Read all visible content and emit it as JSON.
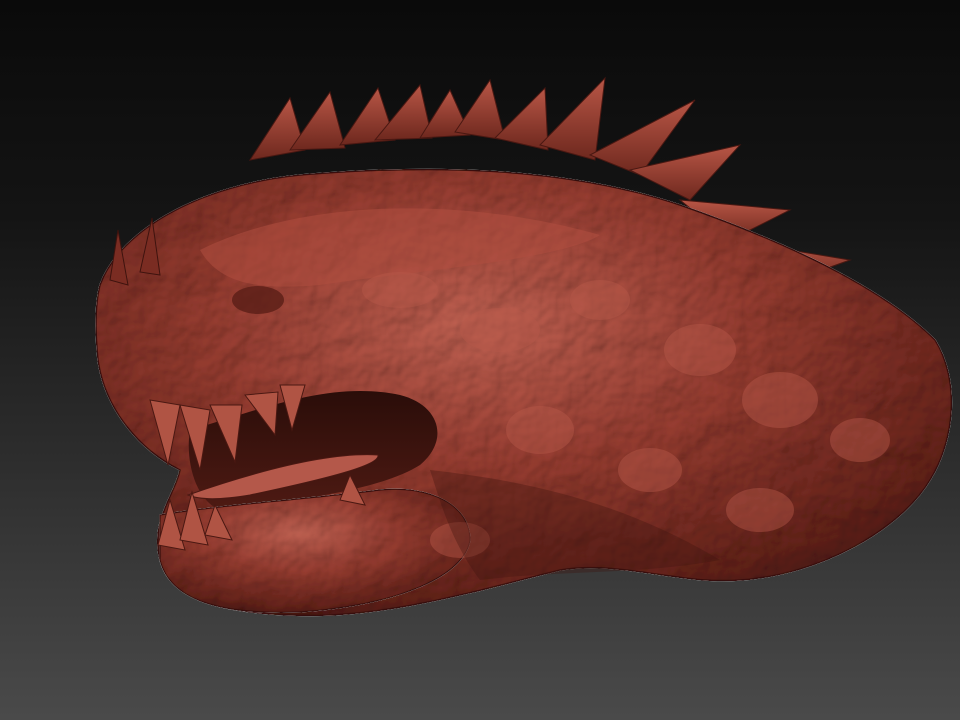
{
  "scene": {
    "subject": "dragon-head-sculpt",
    "colors": {
      "clay": "#9a3e32",
      "clay_light": "#c36252",
      "clay_dark": "#5a1e17",
      "background_top": "#0a0a0a",
      "background_bottom": "#4a4a4a"
    }
  }
}
